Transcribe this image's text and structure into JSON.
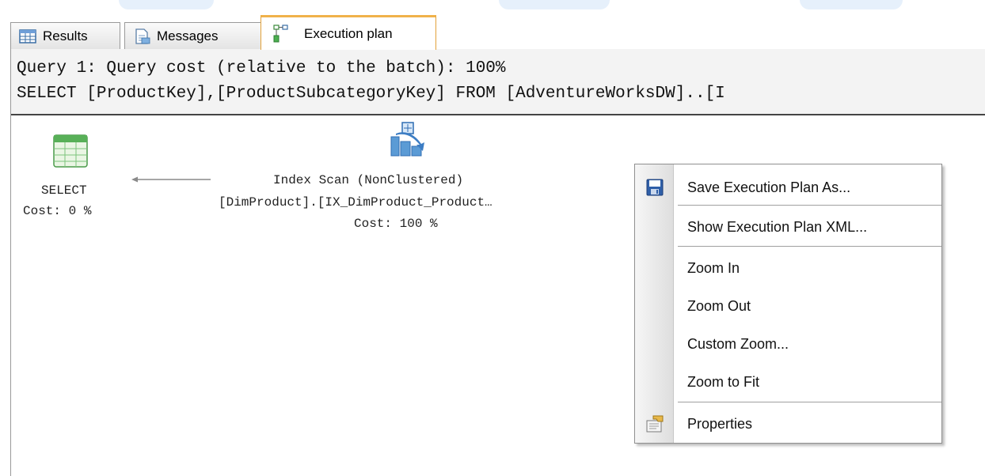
{
  "tabs": [
    {
      "label": "Results",
      "icon": "results-grid-icon",
      "active": false
    },
    {
      "label": "Messages",
      "icon": "messages-icon",
      "active": false
    },
    {
      "label": "Execution plan",
      "icon": "execution-plan-icon",
      "active": true
    }
  ],
  "query": {
    "line1": "Query 1: Query cost (relative to the batch): 100%",
    "line2": "SELECT [ProductKey],[ProductSubcategoryKey] FROM [AdventureWorksDW]..[I"
  },
  "plan": {
    "select_node": {
      "icon": "select-table-icon",
      "name": "SELECT",
      "cost": "Cost: 0 %"
    },
    "index_scan_node": {
      "icon": "index-scan-icon",
      "name": "Index Scan (NonClustered)",
      "object": "[DimProduct].[IX_DimProduct_Product…",
      "cost": "Cost: 100 %"
    }
  },
  "context_menu": {
    "items": [
      {
        "label": "Save Execution Plan As...",
        "icon": "floppy-save-icon"
      },
      {
        "label": "Show Execution Plan XML...",
        "icon": null
      },
      {
        "label": "Zoom In",
        "icon": null
      },
      {
        "label": "Zoom Out",
        "icon": null
      },
      {
        "label": "Custom Zoom...",
        "icon": null
      },
      {
        "label": "Zoom to Fit",
        "icon": null
      },
      {
        "label": "Properties",
        "icon": "properties-icon"
      }
    ]
  },
  "colors": {
    "active_tab_accent": "#f0b24a",
    "header_bg": "#f3f3f3",
    "menu_gutter": "#dedede"
  }
}
